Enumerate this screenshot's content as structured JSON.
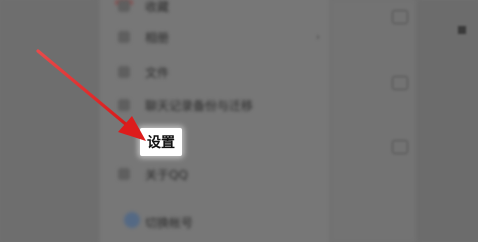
{
  "menu": {
    "items": [
      {
        "label": "收藏"
      },
      {
        "label": "相册"
      },
      {
        "label": "文件"
      },
      {
        "label": "聊天记录备份与迁移"
      },
      {
        "label": "设置"
      },
      {
        "label": "关于QQ"
      },
      {
        "label": "切换帐号"
      }
    ],
    "highlighted_item": "设置"
  },
  "right_column": {
    "time_labels": [
      "",
      "",
      ""
    ]
  },
  "colors": {
    "arrow": "#e02020",
    "highlight_bg": "#ffffff",
    "overlay": "#707070"
  },
  "icons": {
    "arrow": "annotation-arrow-icon",
    "menu_icons": "menu-item-icon"
  }
}
